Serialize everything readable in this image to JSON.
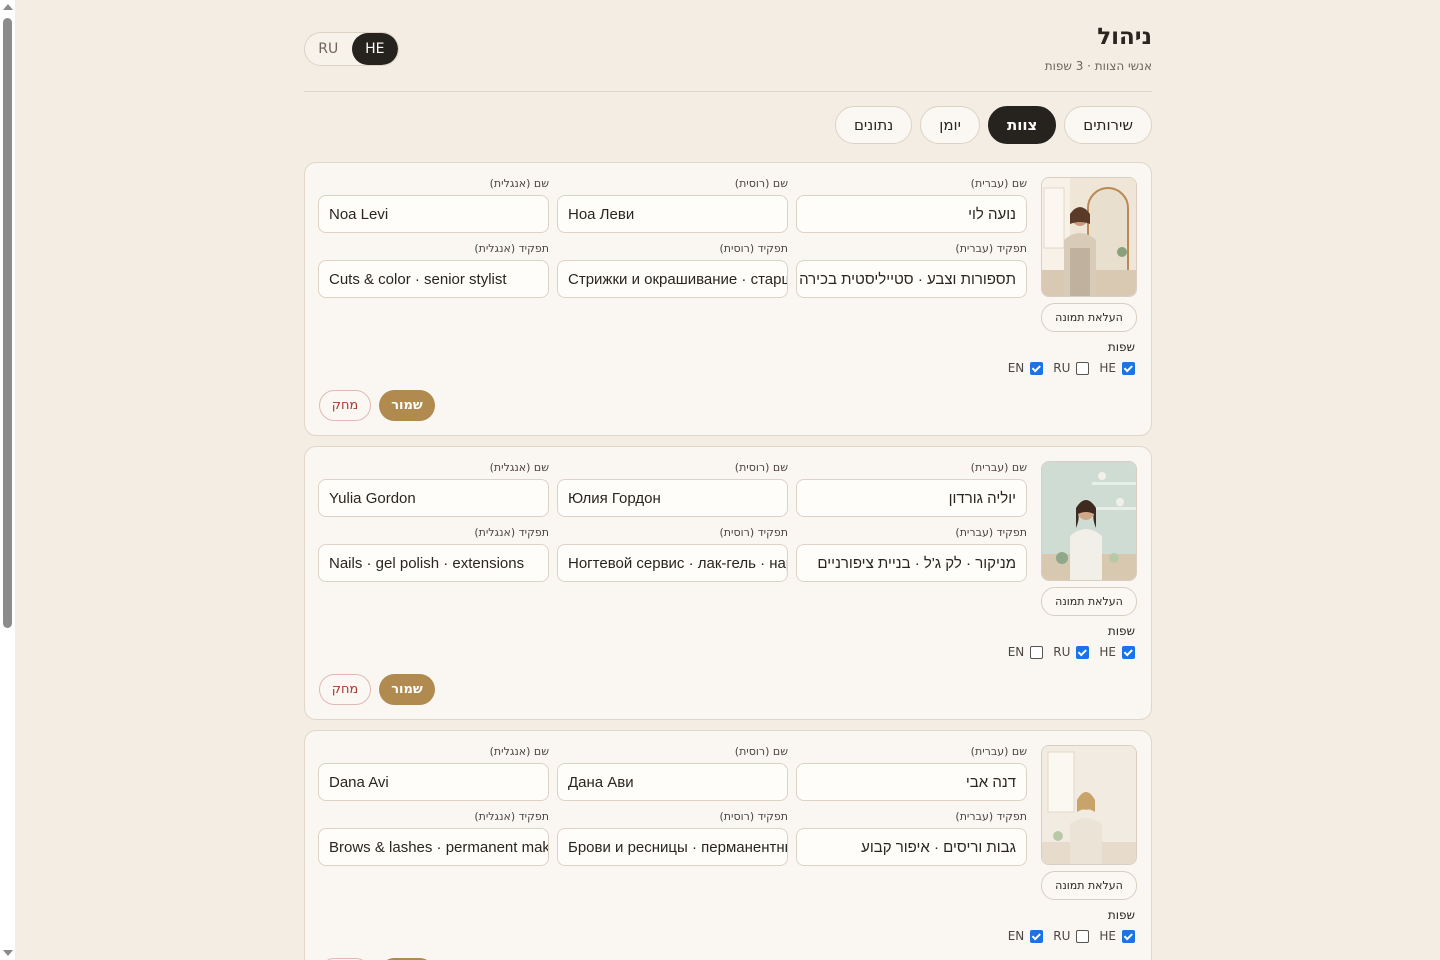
{
  "header": {
    "title": "ניהול",
    "subtitle": "אנשי הצוות · 3 שפות",
    "lang_toggle": [
      {
        "label": "RU",
        "active": false
      },
      {
        "label": "HE",
        "active": true
      }
    ]
  },
  "tabs": [
    {
      "label": "שירותים",
      "active": false
    },
    {
      "label": "צוות",
      "active": true
    },
    {
      "label": "יומן",
      "active": false
    },
    {
      "label": "נתונים",
      "active": false
    }
  ],
  "labels": {
    "name_he": "שם (עברית)",
    "name_ru": "שם (רוסית)",
    "name_en": "שם (אנגלית)",
    "role_he": "תפקיד (עברית)",
    "role_ru": "תפקיד (רוסית)",
    "role_en": "תפקיד (אנגלית)",
    "upload": "העלאת תמונה",
    "languages": "שפות",
    "save": "שמור",
    "delete": "מחק",
    "lang_he": "HE",
    "lang_ru": "RU",
    "lang_en": "EN"
  },
  "staff": [
    {
      "name_he": "נועה לוי",
      "name_ru": "Ноа Леви",
      "name_en": "Noa Levi",
      "role_he": "תספורות וצבע · סטייליסטית בכירה",
      "role_ru": "Стрижки и окрашивание · старший стилист",
      "role_en": "Cuts & color · senior stylist",
      "langs": {
        "he": true,
        "ru": false,
        "en": true
      }
    },
    {
      "name_he": "יוליה גורדון",
      "name_ru": "Юлия Гордон",
      "name_en": "Yulia Gordon",
      "role_he": "מניקור · לק ג'ל · בניית ציפורניים",
      "role_ru": "Ногтевой сервис · лак-гель · наращивание",
      "role_en": "Nails · gel polish · extensions",
      "langs": {
        "he": true,
        "ru": true,
        "en": false
      }
    },
    {
      "name_he": "דנה אבי",
      "name_ru": "Дана Ави",
      "name_en": "Dana Avi",
      "role_he": "גבות וריסים · איפור קבוע",
      "role_ru": "Брови и ресницы · перманентный макияж",
      "role_en": "Brows & lashes · permanent makeup",
      "langs": {
        "he": true,
        "ru": false,
        "en": true
      }
    }
  ],
  "colors": {
    "background": "#f3ede4",
    "accent": "#b08a4f",
    "active_tab": "#26221e",
    "delete_text": "#a33b32",
    "checkbox": "#1a73e8"
  }
}
